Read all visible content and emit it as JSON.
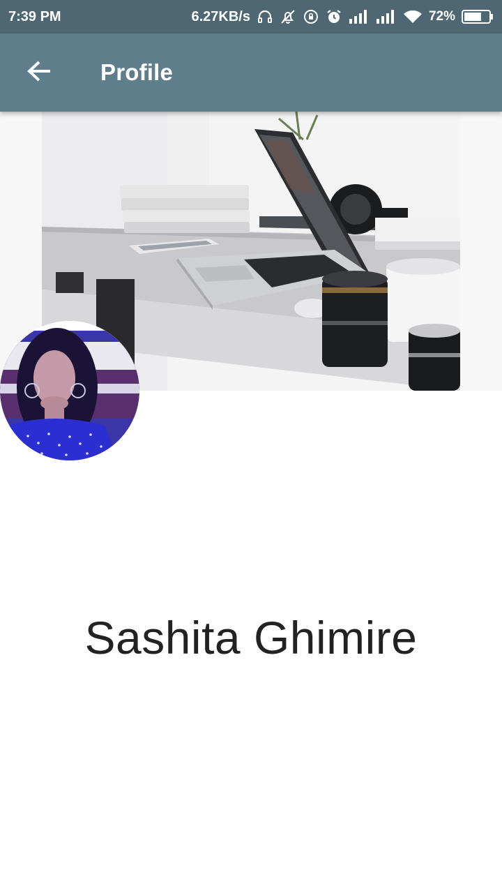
{
  "status_bar": {
    "time": "7:39 PM",
    "network_speed": "6.27KB/s",
    "battery_percent": "72%",
    "battery_level": 0.72,
    "icons": [
      "headset-icon",
      "notifications-off-icon",
      "rotation-lock-icon",
      "alarm-icon",
      "signal-1-icon",
      "signal-2-icon",
      "wifi-icon",
      "battery-icon"
    ]
  },
  "app_bar": {
    "title": "Profile",
    "back_icon": "arrow-back-icon",
    "background": "#607d8b"
  },
  "profile": {
    "name": "Sashita Ghimire",
    "cover_photo": "desk-laptop-photo",
    "avatar": "profile-photo"
  }
}
